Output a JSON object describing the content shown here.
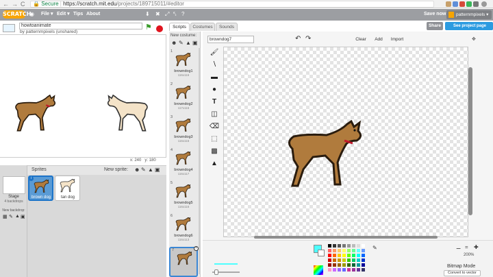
{
  "browser": {
    "back": "←",
    "forward": "→",
    "reload": "C",
    "secure_label": "Secure",
    "url_host": "https://scratch.mit.edu",
    "url_path": "/projects/189715011/#editor"
  },
  "topbar": {
    "logo": "SCRATCH",
    "menu_file": "File ▾",
    "menu_edit": "Edit ▾",
    "menu_tips": "Tips",
    "menu_about": "About",
    "save_now": "Save now",
    "username": "patternmpixels ▾"
  },
  "project": {
    "title": "howtoanimate",
    "byline": "by patternmpixels (unshared)",
    "share_label": "Share",
    "see_page_label": "See project page"
  },
  "stage": {
    "x_label": "x:",
    "x_value": "240",
    "y_label": "y:",
    "y_value": "180"
  },
  "sprites_pane": {
    "header": "Sprites",
    "new_sprite_label": "New sprite:",
    "stage_label": "Stage",
    "stage_backdrops": "4 backdrops",
    "new_backdrop_label": "New backdrop:",
    "sprites": [
      {
        "name": "brown dog",
        "selected": true
      },
      {
        "name": "tan dog",
        "selected": false
      }
    ]
  },
  "tabs": [
    {
      "label": "Scripts",
      "selected": true
    },
    {
      "label": "Costumes",
      "selected": false
    },
    {
      "label": "Sounds",
      "selected": false
    }
  ],
  "costumes": {
    "new_costume_label": "New costume:",
    "items": [
      {
        "num": "1",
        "name": "browndog1",
        "size": "116x116"
      },
      {
        "num": "2",
        "name": "browndog2",
        "size": "117x116"
      },
      {
        "num": "3",
        "name": "browndog3",
        "size": "116x116"
      },
      {
        "num": "4",
        "name": "browndog4",
        "size": "116x117"
      },
      {
        "num": "5",
        "name": "browndog5",
        "size": "116x116"
      },
      {
        "num": "6",
        "name": "browndog6",
        "size": "116x113"
      },
      {
        "num": "7",
        "name": "",
        "size": ""
      }
    ]
  },
  "editor": {
    "costume_name": "browndog7",
    "clear_label": "Clear",
    "add_label": "Add",
    "import_label": "Import",
    "zoom_level": "200%",
    "mode_label": "Bitmap Mode",
    "convert_label": "Convert to vector"
  },
  "colors": {
    "accent": "#f7a400",
    "share_blue": "#2c9be0",
    "selected_blue": "#1c74c9",
    "foreground_color": "#4dffff",
    "dog_brown": "#b07b3d",
    "dog_collar": "#c0182a"
  }
}
